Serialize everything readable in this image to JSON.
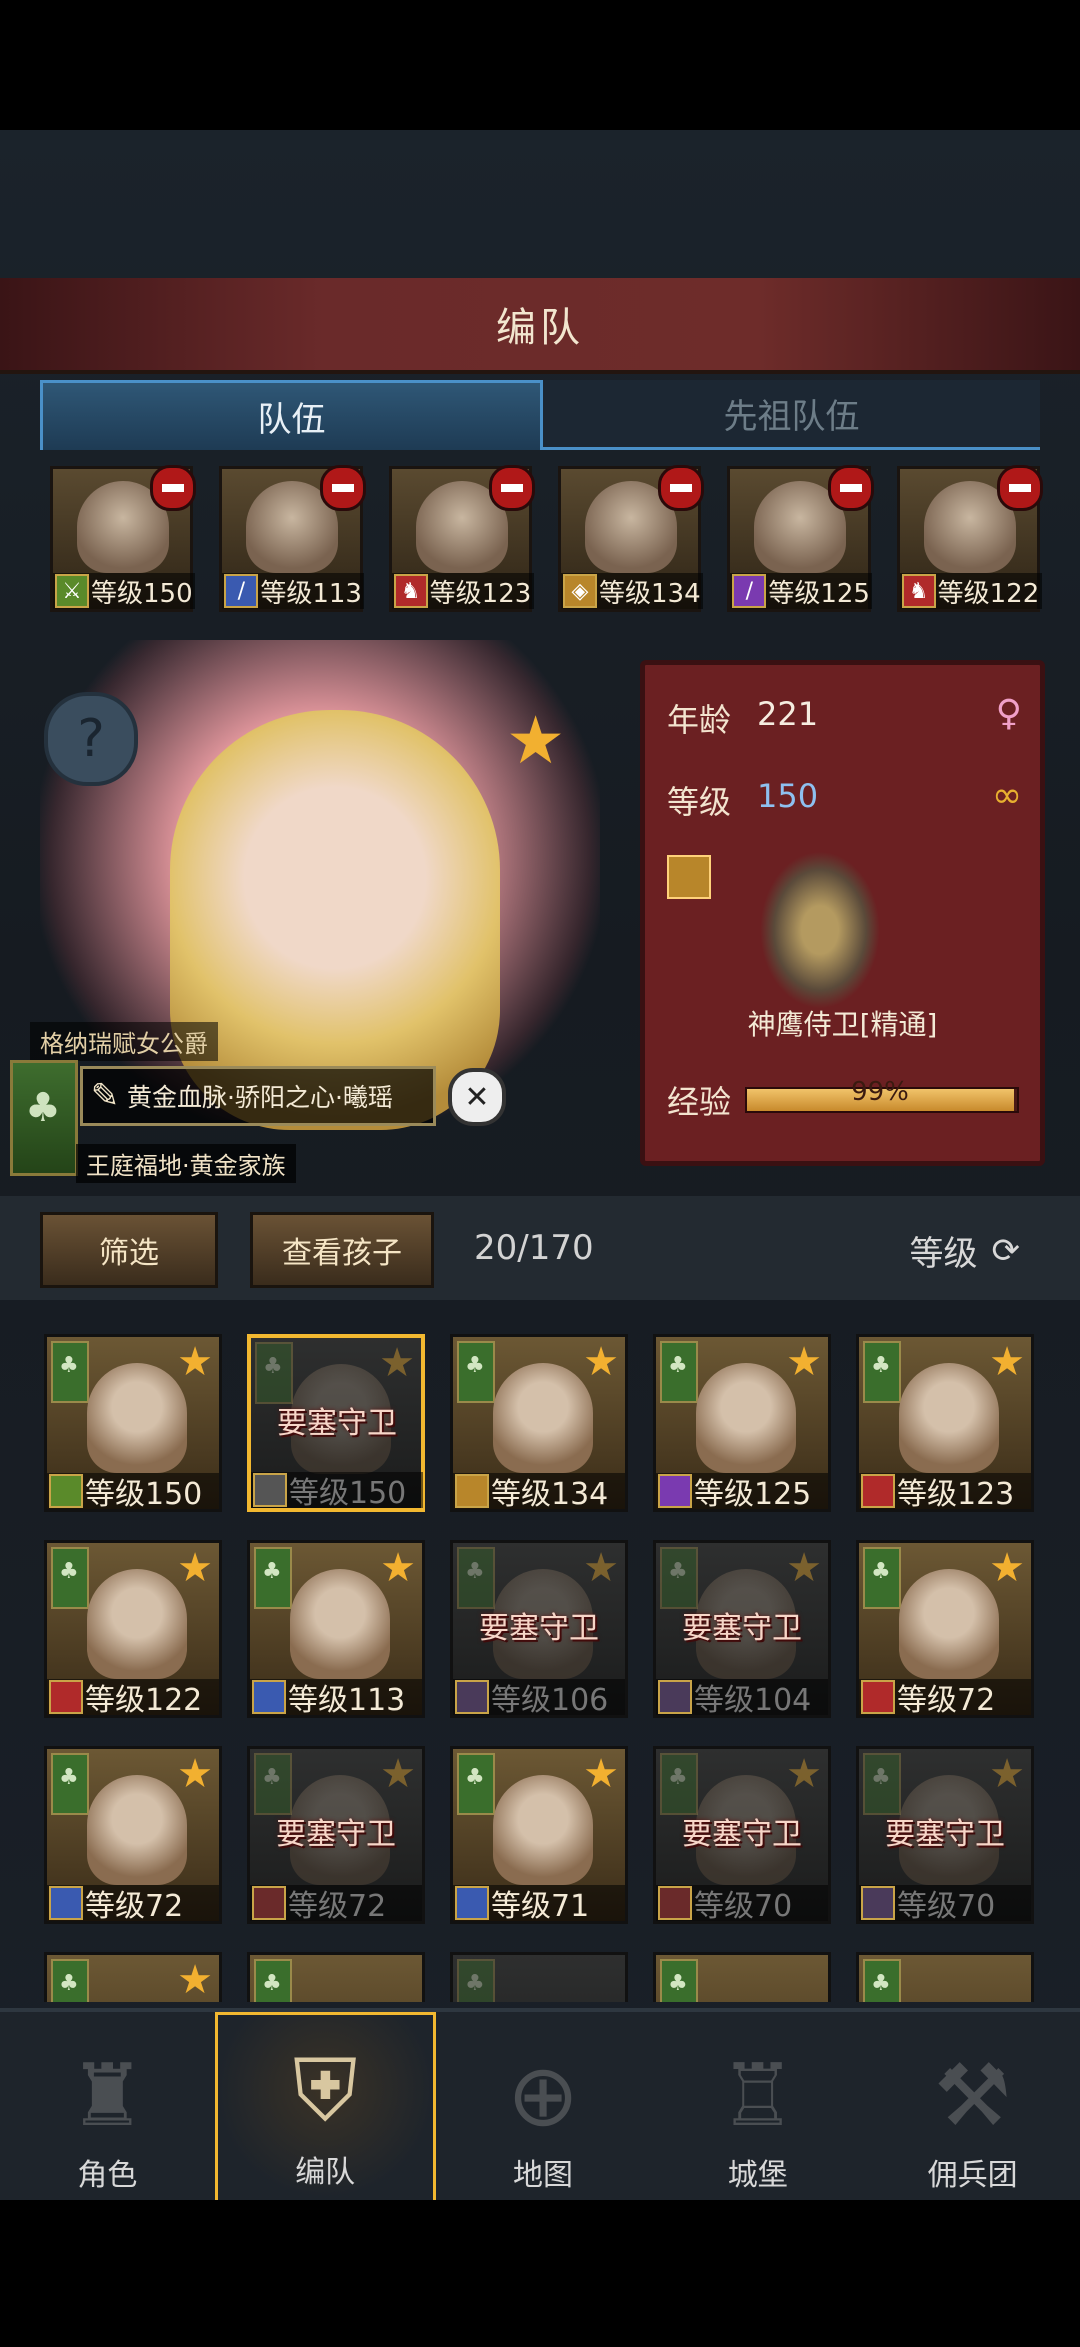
{
  "header": {
    "title": "编队"
  },
  "tabs": [
    {
      "label": "队伍",
      "active": true
    },
    {
      "label": "先祖队伍",
      "active": false
    }
  ],
  "team": [
    {
      "level": "等级150",
      "class_icon": "sword-icon",
      "class_color": "#5a8a2a"
    },
    {
      "level": "等级113",
      "class_icon": "dagger-icon",
      "class_color": "#3a5ab0"
    },
    {
      "level": "等级123",
      "class_icon": "horse-icon",
      "class_color": "#b02a2a"
    },
    {
      "level": "等级134",
      "class_icon": "shield-icon",
      "class_color": "#b8862a"
    },
    {
      "level": "等级125",
      "class_icon": "staff-icon",
      "class_color": "#7a3ab0"
    },
    {
      "level": "等级122",
      "class_icon": "horse-icon",
      "class_color": "#b02a2a"
    }
  ],
  "hero": {
    "title": "格纳瑞赋女公爵",
    "name": "黄金血脉·骄阳之心·曦瑶",
    "house": "王庭福地·黄金家族",
    "age_label": "年龄",
    "age": "221",
    "level_label": "等级",
    "level": "150",
    "unit": "神鹰侍卫[精通]",
    "exp_label": "经验",
    "exp": "99%",
    "exp_fraction": 0.99
  },
  "filter": {
    "filter_label": "筛选",
    "children_label": "查看孩子",
    "count": "20/170",
    "sort_label": "等级"
  },
  "roster": [
    {
      "level": "等级150",
      "locked": false,
      "selected": false,
      "class_color": "#5a8a2a"
    },
    {
      "level": "等级150",
      "locked": true,
      "selected": true,
      "lock_text": "要塞守卫",
      "class_color": "#555"
    },
    {
      "level": "等级134",
      "locked": false,
      "selected": false,
      "class_color": "#b8862a"
    },
    {
      "level": "等级125",
      "locked": false,
      "selected": false,
      "class_color": "#7a3ab0"
    },
    {
      "level": "等级123",
      "locked": false,
      "selected": false,
      "class_color": "#b02a2a"
    },
    {
      "level": "等级122",
      "locked": false,
      "selected": false,
      "class_color": "#b02a2a"
    },
    {
      "level": "等级113",
      "locked": false,
      "selected": false,
      "class_color": "#3a5ab0"
    },
    {
      "level": "等级106",
      "locked": true,
      "selected": false,
      "lock_text": "要塞守卫",
      "class_color": "#4a3a5a"
    },
    {
      "level": "等级104",
      "locked": true,
      "selected": false,
      "lock_text": "要塞守卫",
      "class_color": "#4a3a5a"
    },
    {
      "level": "等级72",
      "locked": false,
      "selected": false,
      "class_color": "#b02a2a"
    },
    {
      "level": "等级72",
      "locked": false,
      "selected": false,
      "class_color": "#3a5ab0"
    },
    {
      "level": "等级72",
      "locked": true,
      "selected": false,
      "lock_text": "要塞守卫",
      "class_color": "#6a2a2a"
    },
    {
      "level": "等级71",
      "locked": false,
      "selected": false,
      "class_color": "#3a5ab0"
    },
    {
      "level": "等级70",
      "locked": true,
      "selected": false,
      "lock_text": "要塞守卫",
      "class_color": "#6a2a2a"
    },
    {
      "level": "等级70",
      "locked": true,
      "selected": false,
      "lock_text": "要塞守卫",
      "class_color": "#4a3a5a"
    }
  ],
  "nav": [
    {
      "label": "角色",
      "icon": "knight-icon",
      "active": false
    },
    {
      "label": "编队",
      "icon": "helmet-icon",
      "active": true
    },
    {
      "label": "地图",
      "icon": "compass-icon",
      "active": false
    },
    {
      "label": "城堡",
      "icon": "castle-icon",
      "active": false
    },
    {
      "label": "佣兵团",
      "icon": "mercenary-icon",
      "active": false
    }
  ]
}
